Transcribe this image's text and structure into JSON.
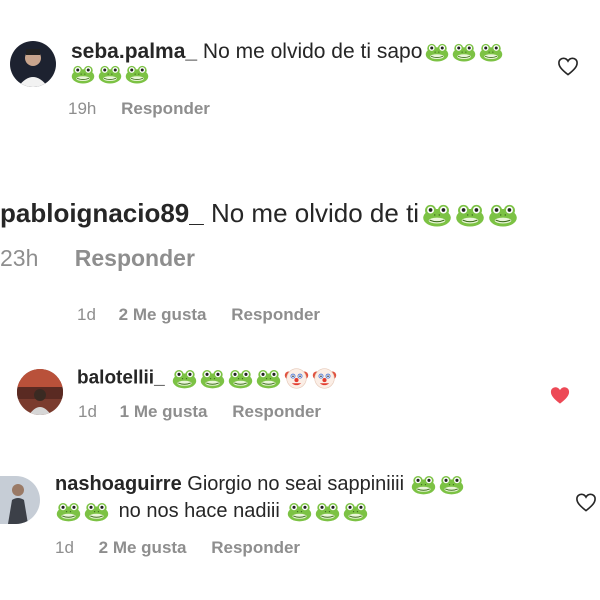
{
  "comments": [
    {
      "username": "seba.palma_",
      "text": "No me olvido de ti sapo",
      "emoji_line1": [
        "frog",
        "frog",
        "frog"
      ],
      "emoji_line2": [
        "frog",
        "frog",
        "frog"
      ],
      "time": "19h",
      "likes": "",
      "reply_label": "Responder",
      "liked": false
    },
    {
      "username": "pabloignacio89_",
      "text": "No me olvido de ti",
      "emoji_line1": [
        "frog",
        "frog",
        "frog"
      ],
      "time": "23h",
      "likes": "",
      "reply_label": "Responder",
      "liked": false
    },
    {
      "username": "",
      "text": "",
      "time": "1d",
      "likes": "2 Me gusta",
      "reply_label": "Responder",
      "liked": false
    },
    {
      "username": "balotellii_",
      "text": "",
      "emoji_line1": [
        "frog",
        "frog",
        "frog",
        "frog",
        "clown",
        "clown"
      ],
      "time": "1d",
      "likes": "1 Me gusta",
      "reply_label": "Responder",
      "liked": true
    },
    {
      "username": "nashoaguirre",
      "text": "Giorgio no seai sappiniiii",
      "text_line2": "no nos hace nadiii",
      "emoji_line1": [
        "frog",
        "frog"
      ],
      "emoji_line2_before": [
        "frog",
        "frog"
      ],
      "emoji_line2_after": [
        "frog",
        "frog",
        "frog"
      ],
      "time": "1d",
      "likes": "2 Me gusta",
      "reply_label": "Responder",
      "liked": false
    }
  ],
  "colors": {
    "text": "#262626",
    "meta": "#8e8e8e",
    "liked_heart": "#ed4956",
    "frog": "#7cc244"
  },
  "icons": [
    "frog-emoji-icon",
    "clown-emoji-icon",
    "heart-outline-icon",
    "heart-filled-icon"
  ]
}
